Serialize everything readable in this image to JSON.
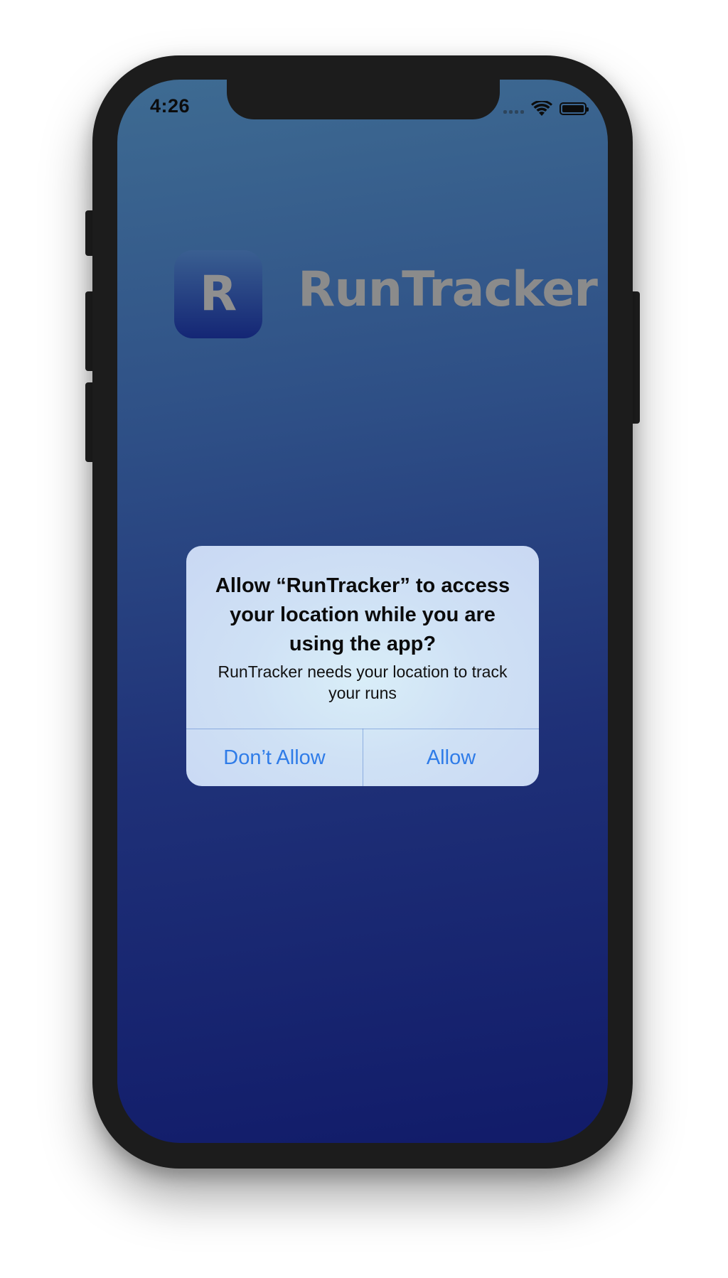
{
  "status_bar": {
    "time": "4:26",
    "signal_icon": "cellular-signal-icon",
    "wifi_icon": "wifi-icon",
    "battery_icon": "battery-icon"
  },
  "app": {
    "logo_letter": "R",
    "title": "RunTracker"
  },
  "alert": {
    "title": "Allow “RunTracker” to access your location while you are using the app?",
    "message": "RunTracker needs your location to track your runs",
    "buttons": {
      "deny_label": "Don’t Allow",
      "allow_label": "Allow"
    }
  },
  "colors": {
    "gradient_top": "#3e6b92",
    "gradient_bottom": "#111b69",
    "alert_button_text": "#2f7ce8",
    "device_frame": "#1c1c1c"
  }
}
